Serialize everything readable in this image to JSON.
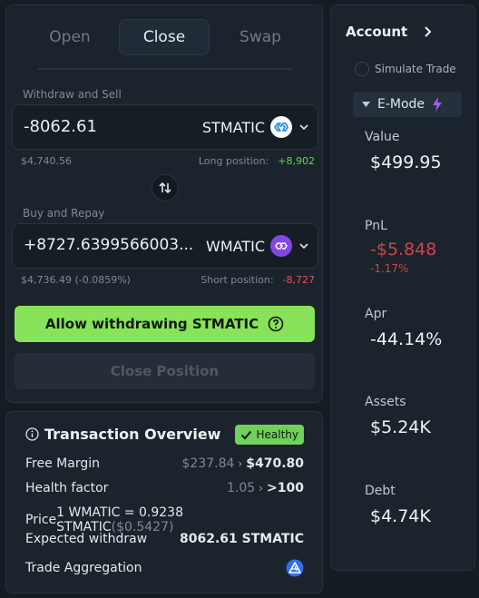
{
  "tabs": {
    "open": "Open",
    "close": "Close",
    "swap": "Swap"
  },
  "withdraw": {
    "label": "Withdraw and Sell",
    "amount": "-8062.61",
    "token": "STMATIC",
    "usd": "$4,740.56",
    "position_label": "Long position:",
    "position_value": "+8,902"
  },
  "repay": {
    "label": "Buy and Repay",
    "amount": "+8727.6399566003...",
    "token": "WMATIC",
    "usd": "$4,736.49 (-0.0859%)",
    "position_label": "Short position:",
    "position_value": "-8,727"
  },
  "buttons": {
    "allow": "Allow withdrawing STMATIC",
    "close_position": "Close Position"
  },
  "overview": {
    "title": "Transaction Overview",
    "badge": "Healthy",
    "free_margin_label": "Free Margin",
    "free_margin_from": "$237.84",
    "free_margin_to": "$470.80",
    "health_label": "Health factor",
    "health_from": "1.05",
    "health_to": ">100",
    "price_label": "Price",
    "price_value": "1 WMATIC = 0.9238 STMATIC",
    "price_usd": "($0.5427)",
    "expected_label": "Expected withdraw",
    "expected_value": "8062.61 STMATIC",
    "aggregation_label": "Trade Aggregation"
  },
  "account": {
    "title": "Account",
    "simulate": "Simulate Trade",
    "emode": "E-Mode",
    "value_label": "Value",
    "value": "$499.95",
    "pnl_label": "PnL",
    "pnl": "-$5.848",
    "pnl_pct": "-1.17%",
    "apr_label": "Apr",
    "apr": "-44.14%",
    "assets_label": "Assets",
    "assets": "$5.24K",
    "debt_label": "Debt",
    "debt": "$4.74K"
  },
  "colors": {
    "accent_green": "#88e35a",
    "negative_red": "#d0434a",
    "stmatic_blue": "#2f8bf0",
    "wmatic_purple": "#8247e5"
  },
  "icons": [
    "stmatic-token-icon",
    "wmatic-token-icon",
    "chevron-down-icon",
    "swap-arrows-icon",
    "question-circle-icon",
    "info-icon",
    "check-icon",
    "chevron-right-icon",
    "lightning-icon",
    "aggregator-icon",
    "triangle-down-icon"
  ]
}
